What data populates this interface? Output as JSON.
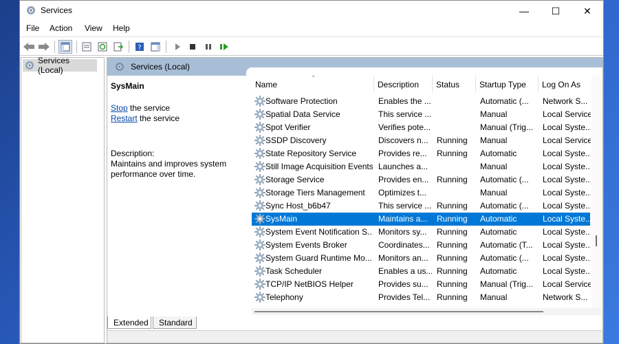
{
  "window": {
    "title": "Services"
  },
  "menu": [
    "File",
    "Action",
    "View",
    "Help"
  ],
  "tree": {
    "root_label": "Services (Local)"
  },
  "pane": {
    "header": "Services (Local)"
  },
  "extended": {
    "service_name": "SysMain",
    "stop_link": "Stop",
    "stop_suffix": " the service",
    "restart_link": "Restart",
    "restart_suffix": " the service",
    "description_label": "Description:",
    "description": "Maintains and improves system performance over time."
  },
  "columns": [
    "Name",
    "Description",
    "Status",
    "Startup Type",
    "Log On As"
  ],
  "rows": [
    {
      "name": "Software Protection",
      "description": "Enables the ...",
      "status": "",
      "startup": "Automatic (...",
      "logon": "Network S..."
    },
    {
      "name": "Spatial Data Service",
      "description": "This service ...",
      "status": "",
      "startup": "Manual",
      "logon": "Local Service"
    },
    {
      "name": "Spot Verifier",
      "description": "Verifies pote...",
      "status": "",
      "startup": "Manual (Trig...",
      "logon": "Local Syste..."
    },
    {
      "name": "SSDP Discovery",
      "description": "Discovers n...",
      "status": "Running",
      "startup": "Manual",
      "logon": "Local Service"
    },
    {
      "name": "State Repository Service",
      "description": "Provides re...",
      "status": "Running",
      "startup": "Automatic",
      "logon": "Local Syste..."
    },
    {
      "name": "Still Image Acquisition Events",
      "description": "Launches a...",
      "status": "",
      "startup": "Manual",
      "logon": "Local Syste..."
    },
    {
      "name": "Storage Service",
      "description": "Provides en...",
      "status": "Running",
      "startup": "Automatic (...",
      "logon": "Local Syste..."
    },
    {
      "name": "Storage Tiers Management",
      "description": "Optimizes t...",
      "status": "",
      "startup": "Manual",
      "logon": "Local Syste..."
    },
    {
      "name": "Sync Host_b6b47",
      "description": "This service ...",
      "status": "Running",
      "startup": "Automatic (...",
      "logon": "Local Syste..."
    },
    {
      "name": "SysMain",
      "description": "Maintains a...",
      "status": "Running",
      "startup": "Automatic",
      "logon": "Local Syste...",
      "selected": true
    },
    {
      "name": "System Event Notification S...",
      "description": "Monitors sy...",
      "status": "Running",
      "startup": "Automatic",
      "logon": "Local Syste..."
    },
    {
      "name": "System Events Broker",
      "description": "Coordinates...",
      "status": "Running",
      "startup": "Automatic (T...",
      "logon": "Local Syste..."
    },
    {
      "name": "System Guard Runtime Mo...",
      "description": "Monitors an...",
      "status": "Running",
      "startup": "Automatic (...",
      "logon": "Local Syste..."
    },
    {
      "name": "Task Scheduler",
      "description": "Enables a us...",
      "status": "Running",
      "startup": "Automatic",
      "logon": "Local Syste..."
    },
    {
      "name": "TCP/IP NetBIOS Helper",
      "description": "Provides su...",
      "status": "Running",
      "startup": "Manual (Trig...",
      "logon": "Local Service"
    },
    {
      "name": "Telephony",
      "description": "Provides Tel...",
      "status": "Running",
      "startup": "Manual",
      "logon": "Network S..."
    }
  ],
  "tabs": [
    "Extended",
    "Standard"
  ],
  "colors": {
    "selection": "#0078d7",
    "pane_header": "#a8bed6",
    "link": "#0645ad"
  },
  "icons": [
    "services-gear-icon",
    "back-arrow-icon",
    "forward-arrow-icon",
    "play-icon",
    "stop-icon",
    "pause-icon",
    "restart-icon",
    "help-icon"
  ]
}
